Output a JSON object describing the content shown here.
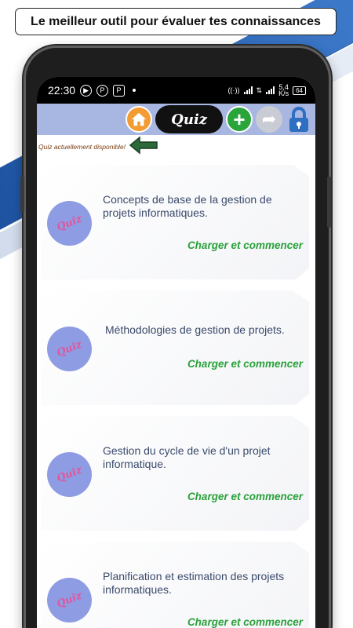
{
  "banner": {
    "text": "Le meilleur outil pour évaluer tes connaissances"
  },
  "status_bar": {
    "time": "22:30",
    "network_speed": "5,4",
    "network_unit": "K/s",
    "battery": "64"
  },
  "toolbar": {
    "title": "Quiz",
    "icons": [
      "home-icon",
      "add-icon",
      "share-icon",
      "lock-icon"
    ]
  },
  "notice": {
    "text": "Quiz actuellement disponible!"
  },
  "badge_label": "Quiz",
  "quizzes": [
    {
      "title": "Concepts de base de la gestion de projets informatiques.",
      "action": "Charger et commencer"
    },
    {
      "title": "Méthodologies de gestion de projets.",
      "action": "Charger et commencer"
    },
    {
      "title": "Gestion du cycle de vie d'un projet informatique.",
      "action": "Charger et commencer"
    },
    {
      "title": "Planification et estimation des projets informatiques.",
      "action": "Charger et commencer"
    }
  ],
  "colors": {
    "toolbar_bg": "#a8b6e2",
    "action_green": "#29a13a",
    "badge_bg": "#8e9de3",
    "badge_text": "#e0569e"
  }
}
